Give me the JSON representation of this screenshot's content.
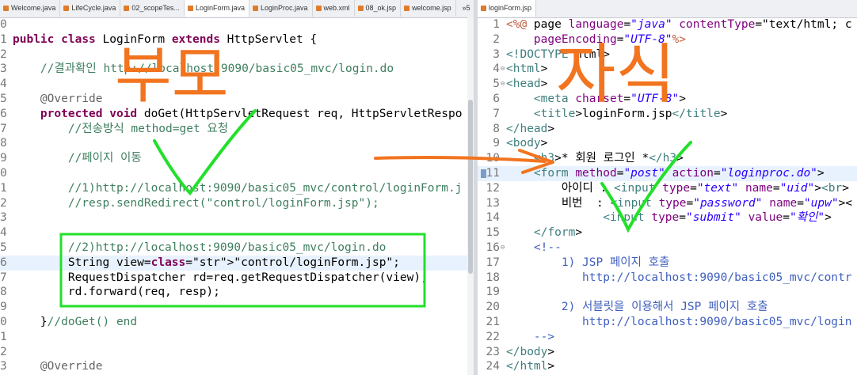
{
  "left_editor": {
    "tabs": [
      "Welcome.java",
      "LifeCycle.java",
      "02_scopeTes...",
      "LoginForm.java",
      "LoginProc.java",
      "web.xml",
      "08_ok.jsp",
      "welcome.jsp",
      "»5"
    ],
    "active_tab": 3,
    "line_numbers": [
      "0",
      "1",
      "2",
      "3",
      "4",
      "5",
      "6",
      "7",
      "8",
      "9",
      "0",
      "1",
      "2",
      "3",
      "4",
      "5",
      "6",
      "7",
      "8",
      "9",
      "0",
      "1",
      "2",
      "3"
    ],
    "code_lines": [
      "",
      "public class LoginForm extends HttpServlet {",
      "",
      "    //결과확인 http://localhost:9090/basic05_mvc/login.do",
      "",
      "    @Override",
      "    protected void doGet(HttpServletRequest req, HttpServletRespo",
      "        //전송방식 method=get 요청",
      "",
      "        //페이지 이동",
      "",
      "        //1)http://localhost:9090/basic05_mvc/control/loginForm.j",
      "        //resp.sendRedirect(\"control/loginForm.jsp\");",
      "",
      "",
      "        //2)http://localhost:9090/basic05_mvc/login.do",
      "        String view=\"control/loginForm.jsp\";",
      "        RequestDispatcher rd=req.getRequestDispatcher(view);",
      "        rd.forward(req, resp);",
      "",
      "    }//doGet() end",
      "",
      "",
      "    @Override"
    ]
  },
  "right_editor": {
    "tab": "loginForm.jsp",
    "line_numbers": [
      "1",
      "2",
      "3",
      "4",
      "5",
      "6",
      "7",
      "8",
      "9",
      "10",
      "11",
      "12",
      "13",
      "14",
      "15",
      "16",
      "17",
      "18",
      "19",
      "20",
      "21",
      "22",
      "23",
      "24"
    ],
    "code_lines": [
      "<%@ page language=\"java\" contentType=\"text/html; c",
      "    pageEncoding=\"UTF-8\"%>",
      "<!DOCTYPE html>",
      "<html>",
      "<head>",
      "    <meta charset=\"UTF-8\">",
      "    <title>loginForm.jsp</title>",
      "</head>",
      "<body>",
      "    <h3>* 회원 로그인 *</h3>",
      "    <form method=\"post\" action=\"loginproc.do\">",
      "        아이디 : <input type=\"text\" name=\"uid\"><br>",
      "        비번  : <input type=\"password\" name=\"upw\"><",
      "              <input type=\"submit\" value=\"확인\">",
      "    </form>",
      "    <!--",
      "        1) JSP 페이지 호출",
      "           http://localhost:9090/basic05_mvc/contr",
      "",
      "        2) 서블릿을 이용해서 JSP 페이지 호출",
      "           http://localhost:9090/basic05_mvc/login",
      "    -->",
      "</body>",
      "</html>"
    ]
  },
  "annotations": {
    "parent_label": "부모",
    "child_label": "자식",
    "ink_green": "#22e02a",
    "ink_orange": "#f2741f",
    "highlight_line_color": "#e8f2fe"
  }
}
